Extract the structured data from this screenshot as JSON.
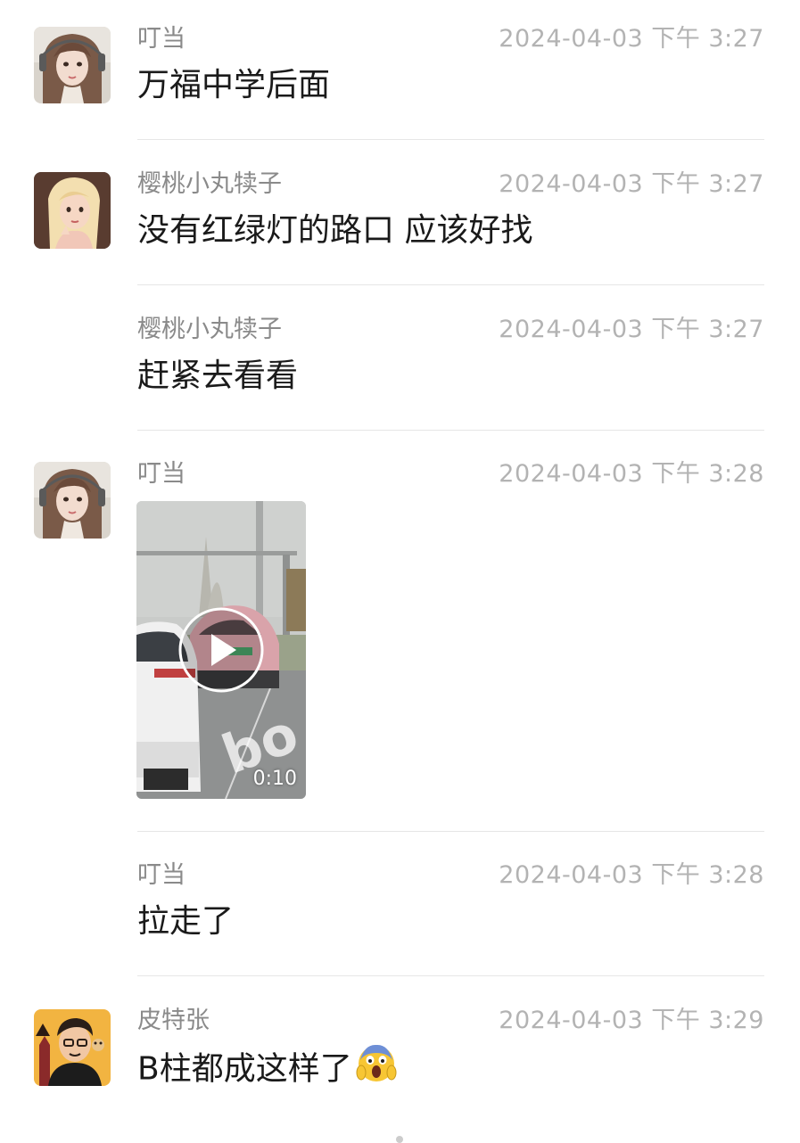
{
  "messages": [
    {
      "sender": "叮当",
      "time": "2024-04-03 下午 3:27",
      "text": "万福中学后面",
      "avatar": "girl-headphones"
    },
    {
      "sender": "樱桃小丸犊子",
      "time": "2024-04-03 下午 3:27",
      "text": "没有红绿灯的路口 应该好找",
      "avatar": "cartoon-girl"
    },
    {
      "sender": "樱桃小丸犊子",
      "time": "2024-04-03 下午 3:27",
      "text": "赶紧去看看",
      "avatar": ""
    },
    {
      "sender": "叮当",
      "time": "2024-04-03 下午 3:28",
      "video_duration": "0:10",
      "avatar": "girl-headphones"
    },
    {
      "sender": "叮当",
      "time": "2024-04-03 下午 3:28",
      "text": "拉走了",
      "avatar": ""
    },
    {
      "sender": "皮特张",
      "time": "2024-04-03 下午 3:29",
      "text": "B柱都成这样了",
      "emoji": "screaming-face-emoji",
      "avatar": "man-cartoon"
    }
  ],
  "colors": {
    "sender": "#8a8a8a",
    "time": "#b3b3b3",
    "text": "#1a1a1a",
    "divider": "#e6e6e6"
  }
}
